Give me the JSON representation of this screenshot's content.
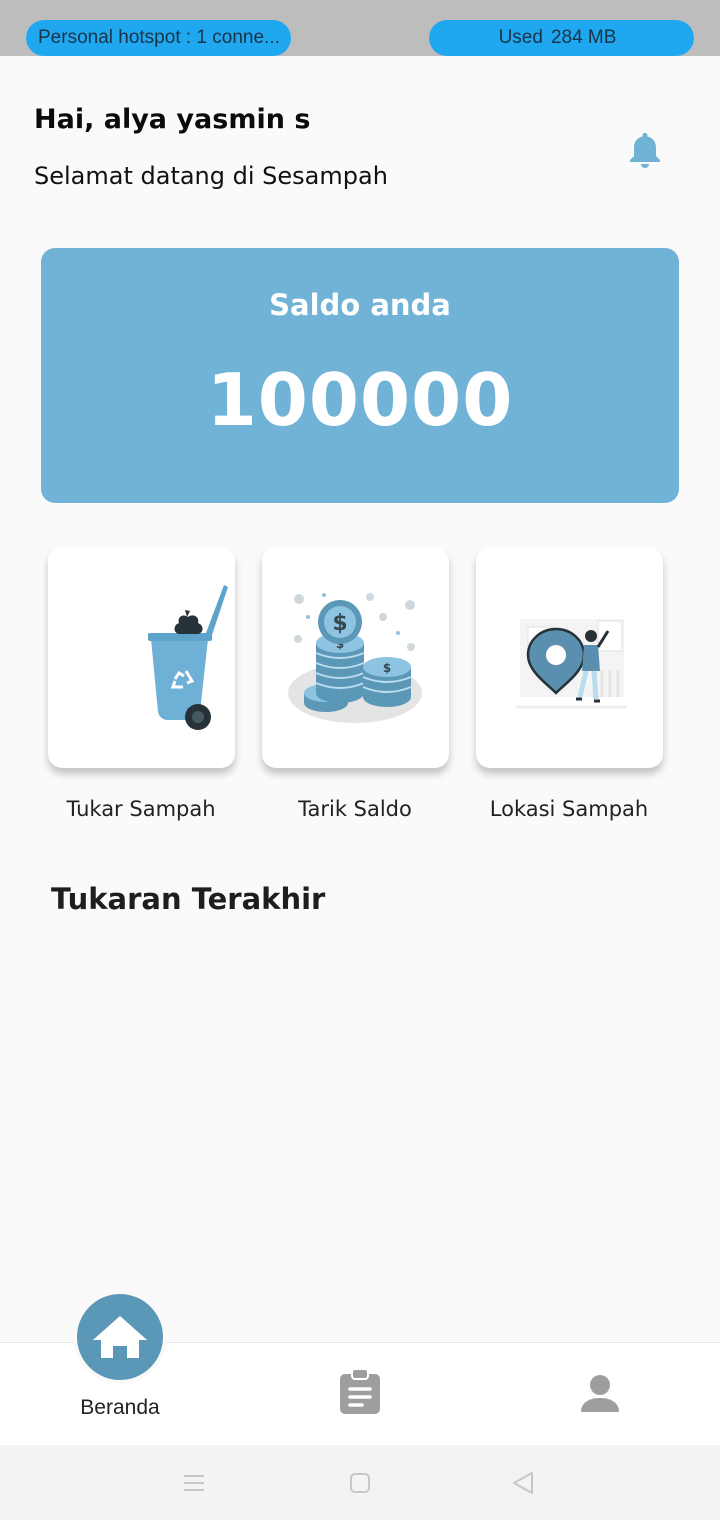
{
  "status_bar": {
    "hotspot_text": "Personal hotspot : 1 conne...",
    "data_used_label": "Used",
    "data_used_value": "284 MB"
  },
  "header": {
    "greeting": "Hai, alya yasmin s",
    "welcome": "Selamat datang di Sesampah",
    "notification_icon": "bell-icon"
  },
  "saldo": {
    "title": "Saldo anda",
    "amount": "100000"
  },
  "menu": [
    {
      "label": "Tukar Sampah",
      "icon": "recycle-bin-icon"
    },
    {
      "label": "Tarik Saldo",
      "icon": "coins-icon"
    },
    {
      "label": "Lokasi Sampah",
      "icon": "location-pin-icon"
    }
  ],
  "section_title": "Tukaran Terakhir",
  "bottom_nav": {
    "items": [
      {
        "label": "Beranda",
        "icon": "home-icon",
        "active": true
      },
      {
        "label": "",
        "icon": "clipboard-icon",
        "active": false
      },
      {
        "label": "",
        "icon": "person-icon",
        "active": false
      }
    ]
  },
  "colors": {
    "accent": "#71b3d6",
    "nav_active": "#5b98b8",
    "status_pill": "#1fa8ef",
    "icon_inactive": "#9e9e9e"
  }
}
